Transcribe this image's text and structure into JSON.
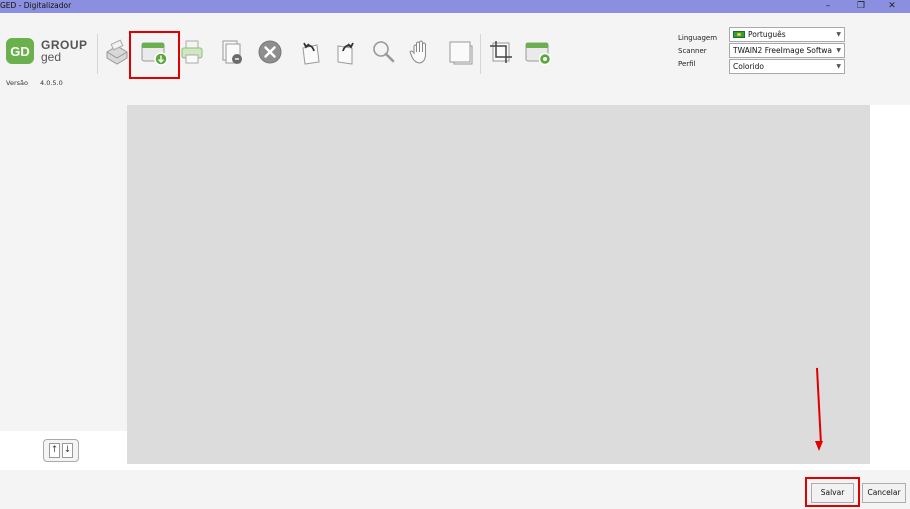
{
  "window": {
    "title": "GED - Digitalizador",
    "minimize_glyph": "–",
    "restore_glyph": "❐",
    "close_glyph": "✕"
  },
  "brand": {
    "logo_line1": "GROUP",
    "logo_line2": "ged",
    "version_label": "Versão",
    "version_number": "4.0.5.0",
    "accent_color": "#6ab04c"
  },
  "toolbar": {
    "icons": [
      "scanner-icon",
      "scan-new-icon",
      "print-icon",
      "document-add-icon",
      "delete-icon",
      "rotate-left-icon",
      "rotate-right-icon",
      "zoom-icon",
      "pan-hand-icon",
      "page-icon",
      "crop-icon",
      "settings-window-icon"
    ]
  },
  "settings": {
    "language_label": "Linguagem",
    "language_value": "Português",
    "scanner_label": "Scanner",
    "scanner_value": "TWAIN2 FreeImage Softwa",
    "profile_label": "Perfil",
    "profile_value": "Colorido"
  },
  "sidebar": {
    "scroll_up_glyph": "↑",
    "scroll_down_glyph": "↓"
  },
  "footer": {
    "save_label": "Salvar",
    "cancel_label": "Cancelar"
  },
  "annotation_color": "#e00000"
}
